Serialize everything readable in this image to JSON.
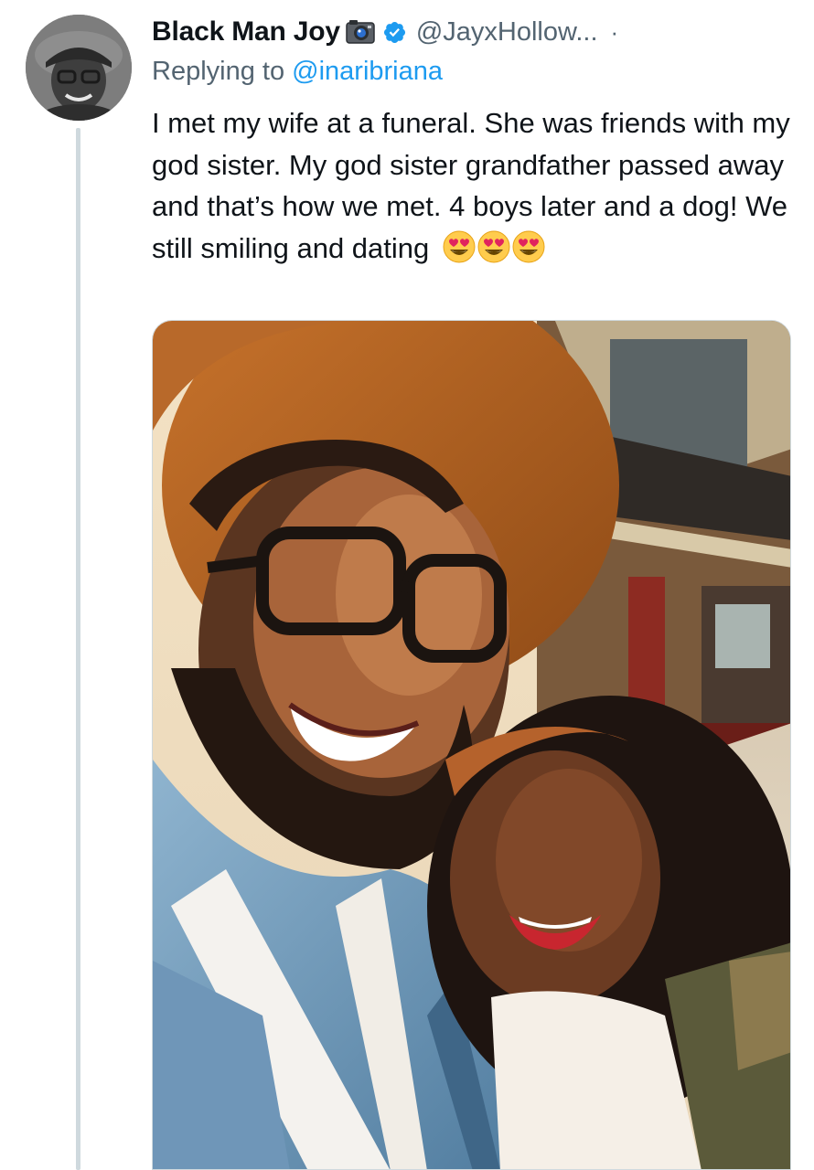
{
  "tweet": {
    "author": {
      "display_name": "Black Man Joy",
      "handle": "@JayxHollow...",
      "separator": "·",
      "badge_icon": "camera-emoji-icon",
      "verified_icon": "verified-badge-icon",
      "verified_color": "#1d9bf0"
    },
    "reply": {
      "prefix": "Replying to",
      "mention": "@inaribriana"
    },
    "text": "I met my wife at a funeral. She was friends with my god sister. My god sister grandfather passed away and that’s how we met. 4 boys later and a dog! We still smiling and dating",
    "emojis": [
      "smiling-face-with-heart-eyes",
      "smiling-face-with-heart-eyes",
      "smiling-face-with-heart-eyes"
    ],
    "media": {
      "type": "photo",
      "description_icon": "selfie-photo"
    }
  },
  "colors": {
    "text": "#0f1419",
    "secondary": "#536471",
    "link": "#1d9bf0",
    "thread_line": "#cfd9de"
  }
}
